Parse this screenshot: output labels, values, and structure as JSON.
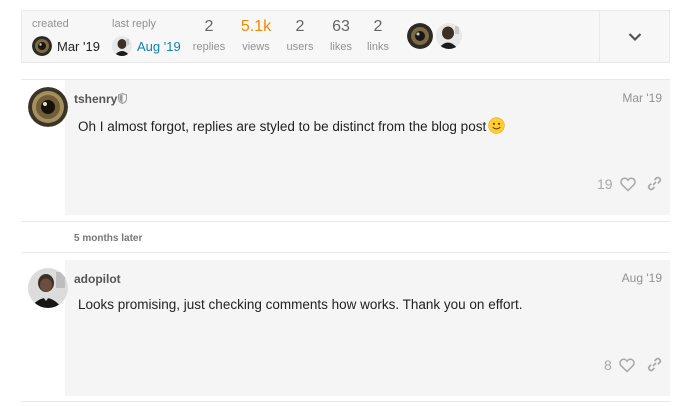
{
  "topic_map": {
    "created_label": "created",
    "created_date": "Mar '19",
    "last_reply_label": "last reply",
    "last_reply_date": "Aug '19",
    "stats": [
      {
        "num": "2",
        "label": "replies"
      },
      {
        "num": "5.1k",
        "label": "views"
      },
      {
        "num": "2",
        "label": "users"
      },
      {
        "num": "63",
        "label": "likes"
      },
      {
        "num": "2",
        "label": "links"
      }
    ],
    "participant_count": "2"
  },
  "posts": [
    {
      "username": "tshenry",
      "date": "Mar '19",
      "body": "Oh I almost forgot, replies are styled to be distinct from the blog post",
      "likes": "19"
    },
    {
      "username": "adopilot",
      "date": "Aug '19",
      "body": "Looks promising, just checking comments how works. Thank you on effort.",
      "likes": "8"
    }
  ],
  "time_gap": "5 months later",
  "colors": {
    "accent_blue": "#0f82af",
    "hot_orange": "#f08a00",
    "muted": "#919191",
    "post_bg": "#f5f5f5"
  }
}
